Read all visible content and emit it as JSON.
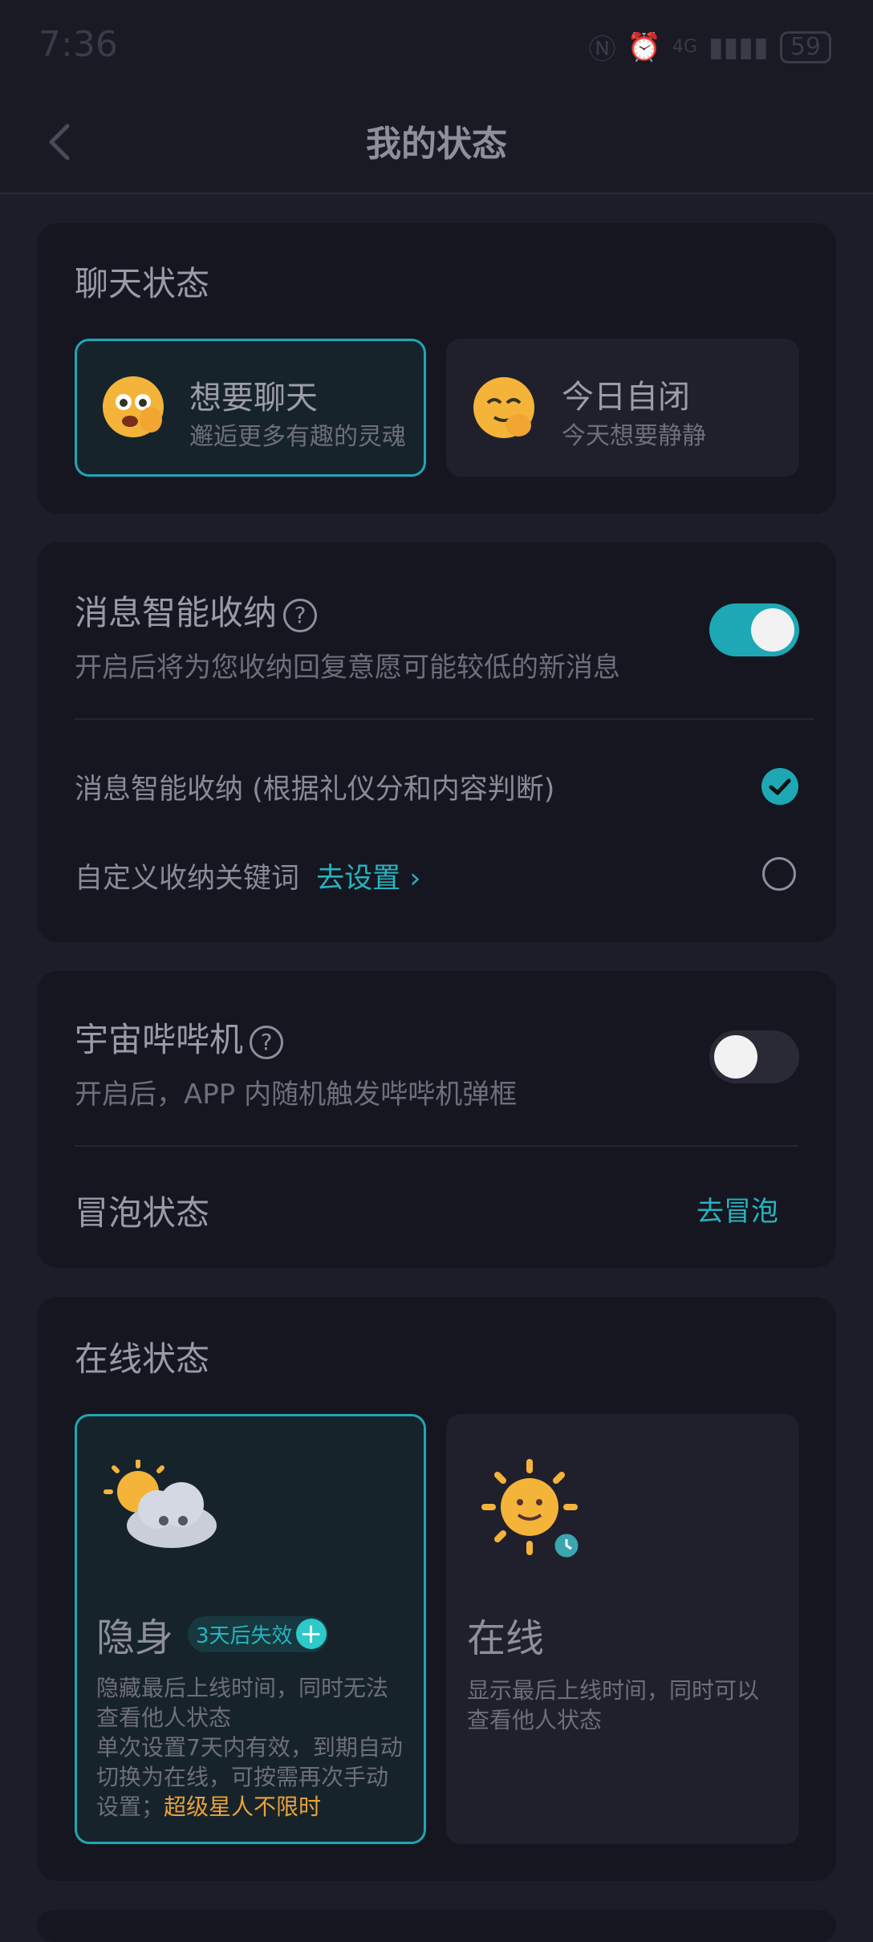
{
  "status_bar": {
    "time": "7:36",
    "network": "4G",
    "battery": "59"
  },
  "header": {
    "title": "我的状态"
  },
  "chat_status": {
    "title": "聊天状态",
    "options": [
      {
        "label": "想要聊天",
        "desc": "邂逅更多有趣的灵魂",
        "selected": true
      },
      {
        "label": "今日自闭",
        "desc": "今天想要静静",
        "selected": false
      }
    ]
  },
  "smart_inbox": {
    "title": "消息智能收纳",
    "help": "?",
    "desc": "开启后将为您收纳回复意愿可能较低的新消息",
    "enabled": true,
    "options": [
      {
        "label": "消息智能收纳 (根据礼仪分和内容判断)",
        "checked": true
      },
      {
        "label": "自定义收纳关键词",
        "link": "去设置",
        "checked": false
      }
    ]
  },
  "cosmic_beeper": {
    "title": "宇宙哔哔机",
    "help": "?",
    "desc": "开启后，APP 内随机触发哔哔机弹框",
    "enabled": false,
    "bubble_label": "冒泡状态",
    "bubble_action": "去冒泡"
  },
  "online_status": {
    "title": "在线状态",
    "options": [
      {
        "label": "隐身",
        "badge": "3天后失效",
        "desc1": "隐藏最后上线时间，同时无法查看他人状态",
        "desc2": "单次设置7天内有效，到期自动切换为在线，可按需再次手动设置；",
        "highlight": "超级星人不限时",
        "selected": true
      },
      {
        "label": "在线",
        "desc1": "显示最后上线时间，同时可以查看他人状态",
        "selected": false
      }
    ]
  },
  "colors": {
    "accent": "#1ea7b4",
    "highlight": "#e9a23b",
    "background": "#1d1d29",
    "card": "#161620"
  }
}
